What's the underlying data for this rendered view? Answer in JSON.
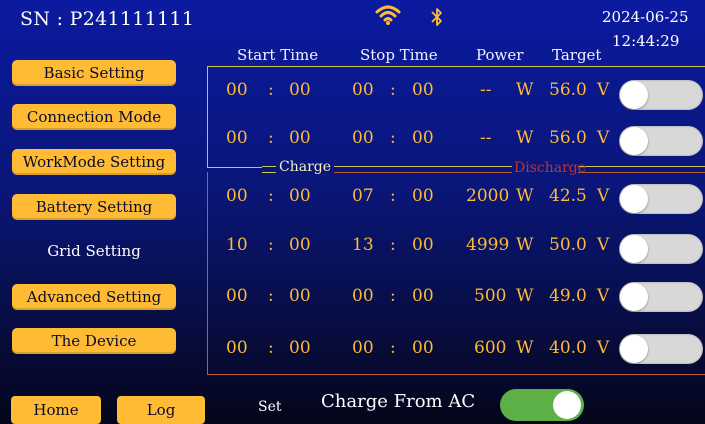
{
  "header": {
    "serial": "SN : P241111111",
    "date": "2024-06-25",
    "time": "12:44:29",
    "icons": [
      "wifi-icon",
      "bluetooth-icon"
    ],
    "accent_color": "#ffbb33"
  },
  "sidebar": {
    "items": [
      {
        "label": "Basic Setting",
        "selected": false
      },
      {
        "label": "Connection Mode",
        "selected": false
      },
      {
        "label": "WorkMode Setting",
        "selected": false
      },
      {
        "label": "Battery Setting",
        "selected": false
      },
      {
        "label": "Grid Setting",
        "selected": true
      },
      {
        "label": "Advanced Setting",
        "selected": false
      },
      {
        "label": "The Device",
        "selected": false
      }
    ]
  },
  "bottom": {
    "home": "Home",
    "log": "Log",
    "set": "Set",
    "charge_from_ac_label": "Charge From AC",
    "charge_from_ac_on": true
  },
  "table": {
    "headers": {
      "start": "Start Time",
      "stop": "Stop Time",
      "power": "Power",
      "target": "Target"
    },
    "sections": {
      "charge": "Charge",
      "discharge": "Discharge"
    },
    "rows": [
      {
        "sh": "00",
        "sm": "00",
        "eh": "00",
        "em": "00",
        "power": "--",
        "power_unit": "W",
        "target": "56.0",
        "target_unit": "V",
        "enabled": false
      },
      {
        "sh": "00",
        "sm": "00",
        "eh": "00",
        "em": "00",
        "power": "--",
        "power_unit": "W",
        "target": "56.0",
        "target_unit": "V",
        "enabled": false
      },
      {
        "sh": "00",
        "sm": "00",
        "eh": "07",
        "em": "00",
        "power": "2000",
        "power_unit": "W",
        "target": "42.5",
        "target_unit": "V",
        "enabled": false
      },
      {
        "sh": "10",
        "sm": "00",
        "eh": "13",
        "em": "00",
        "power": "4999",
        "power_unit": "W",
        "target": "50.0",
        "target_unit": "V",
        "enabled": false
      },
      {
        "sh": "00",
        "sm": "00",
        "eh": "00",
        "em": "00",
        "power": "500",
        "power_unit": "W",
        "target": "49.0",
        "target_unit": "V",
        "enabled": false
      },
      {
        "sh": "00",
        "sm": "00",
        "eh": "00",
        "em": "00",
        "power": "600",
        "power_unit": "W",
        "target": "40.0",
        "target_unit": "V",
        "enabled": false
      }
    ],
    "separator": ":"
  }
}
